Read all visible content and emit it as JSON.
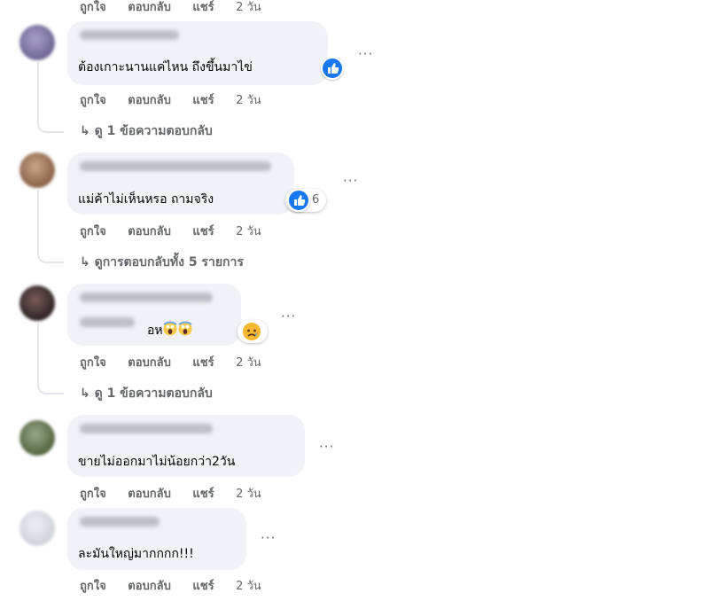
{
  "top_actions": {
    "like": "ถูกใจ",
    "reply": "ตอบกลับ",
    "share": "แชร์",
    "time": "2 วัน"
  },
  "comments": [
    {
      "text": "ต้องเกาะนานแค่ไหน ถึงขึ้นมาไข่",
      "actions": {
        "like": "ถูกใจ",
        "reply": "ตอบกลับ",
        "share": "แชร์",
        "time": "2 วัน"
      },
      "replies": "↳ ดู 1 ข้อความตอบกลับ",
      "reaction": "like"
    },
    {
      "text": "แม่ค้าไม่เห็นหรอ ถามจริง",
      "actions": {
        "like": "ถูกใจ",
        "reply": "ตอบกลับ",
        "share": "แชร์",
        "time": "2 วัน"
      },
      "replies": "↳ ดูการตอบกลับทั้ง 5 รายการ",
      "reaction": "like",
      "reaction_count": "6"
    },
    {
      "text": "อห",
      "actions": {
        "like": "ถูกใจ",
        "reply": "ตอบกลับ",
        "share": "แชร์",
        "time": "2 วัน"
      },
      "replies": "↳ ดู 1 ข้อความตอบกลับ",
      "reaction": "sad"
    },
    {
      "text": "ขายไม่ออกมาไม่น้อยกว่า2วัน",
      "actions": {
        "like": "ถูกใจ",
        "reply": "ตอบกลับ",
        "share": "แชร์",
        "time": "2 วัน"
      }
    },
    {
      "text": "ละมันใหญ่มากกกก!!!",
      "actions": {
        "like": "ถูกใจ",
        "reply": "ตอบกลับ",
        "share": "แชร์",
        "time": "2 วัน"
      }
    }
  ],
  "more_label": "···",
  "colors": {
    "like_blue": "#1877f2",
    "bubble": "#f0f2f5",
    "meta_gray": "#65676b"
  }
}
